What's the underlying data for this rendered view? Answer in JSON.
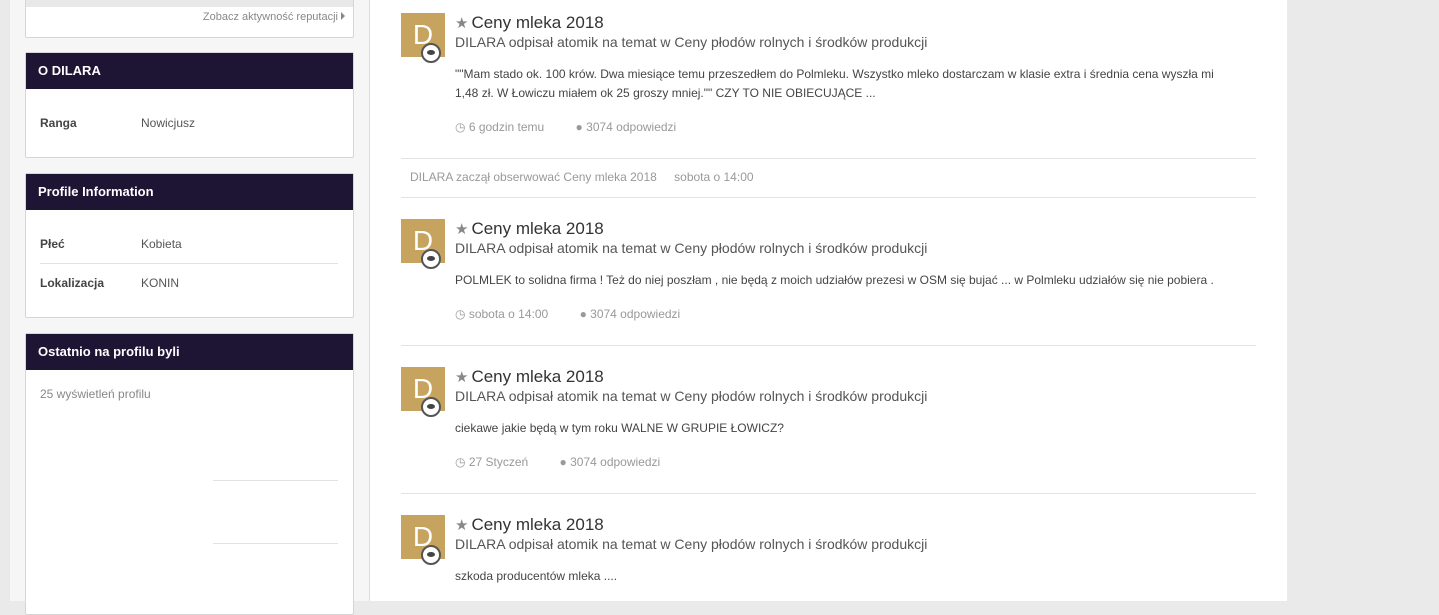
{
  "sidebar": {
    "reputation_link": "Zobacz aktywność reputacji",
    "about": {
      "title": "O DILARA",
      "rows": [
        {
          "label": "Ranga",
          "value": "Nowicjusz"
        }
      ]
    },
    "profile_info": {
      "title": "Profile Information",
      "rows": [
        {
          "label": "Płeć",
          "value": "Kobieta"
        },
        {
          "label": "Lokalizacja",
          "value": "KONIN"
        }
      ]
    },
    "visitors": {
      "title": "Ostatnio na profilu byli",
      "views": "25 wyświetleń profilu"
    }
  },
  "feed": {
    "items": [
      {
        "avatar_letter": "D",
        "title": "Ceny mleka 2018",
        "subtitle": "DILARA odpisał atomik na temat w Ceny płodów rolnych i środków produkcji",
        "body_line1": "\"\"Mam stado ok. 100 krów. Dwa miesiące temu przeszedłem do Polmleku. Wszystko mleko dostarczam w klasie extra i średnia cena wyszła mi",
        "body_line2": "1,48 zł. W Łowiczu miałem ok 25 groszy mniej.\"\" CZY TO NIE OBIECUJĄCE ...",
        "time": "6 godzin temu",
        "replies": "3074 odpowiedzi"
      },
      {
        "avatar_letter": "D",
        "title": "Ceny mleka 2018",
        "subtitle": "DILARA odpisał atomik na temat w Ceny płodów rolnych i środków produkcji",
        "body_line1": "POLMLEK to solidna firma ! Też do niej poszłam , nie będą z moich udziałów prezesi w OSM się bujać ... w Polmleku udziałów się nie pobiera .",
        "time": "sobota o 14:00",
        "replies": "3074 odpowiedzi"
      },
      {
        "avatar_letter": "D",
        "title": "Ceny mleka 2018",
        "subtitle": "DILARA odpisał atomik na temat w Ceny płodów rolnych i środków produkcji",
        "body_line1": "ciekawe jakie będą w tym roku WALNE W GRUPIE ŁOWICZ?",
        "time": "27 Styczeń",
        "replies": "3074 odpowiedzi"
      },
      {
        "avatar_letter": "D",
        "title": "Ceny mleka 2018",
        "subtitle": "DILARA odpisał atomik na temat w Ceny płodów rolnych i środków produkcji",
        "body_line1": "szkoda producentów mleka ...."
      }
    ],
    "activity": {
      "text": "DILARA zaczął obserwować Ceny mleka 2018",
      "time": "sobota o 14:00"
    }
  }
}
